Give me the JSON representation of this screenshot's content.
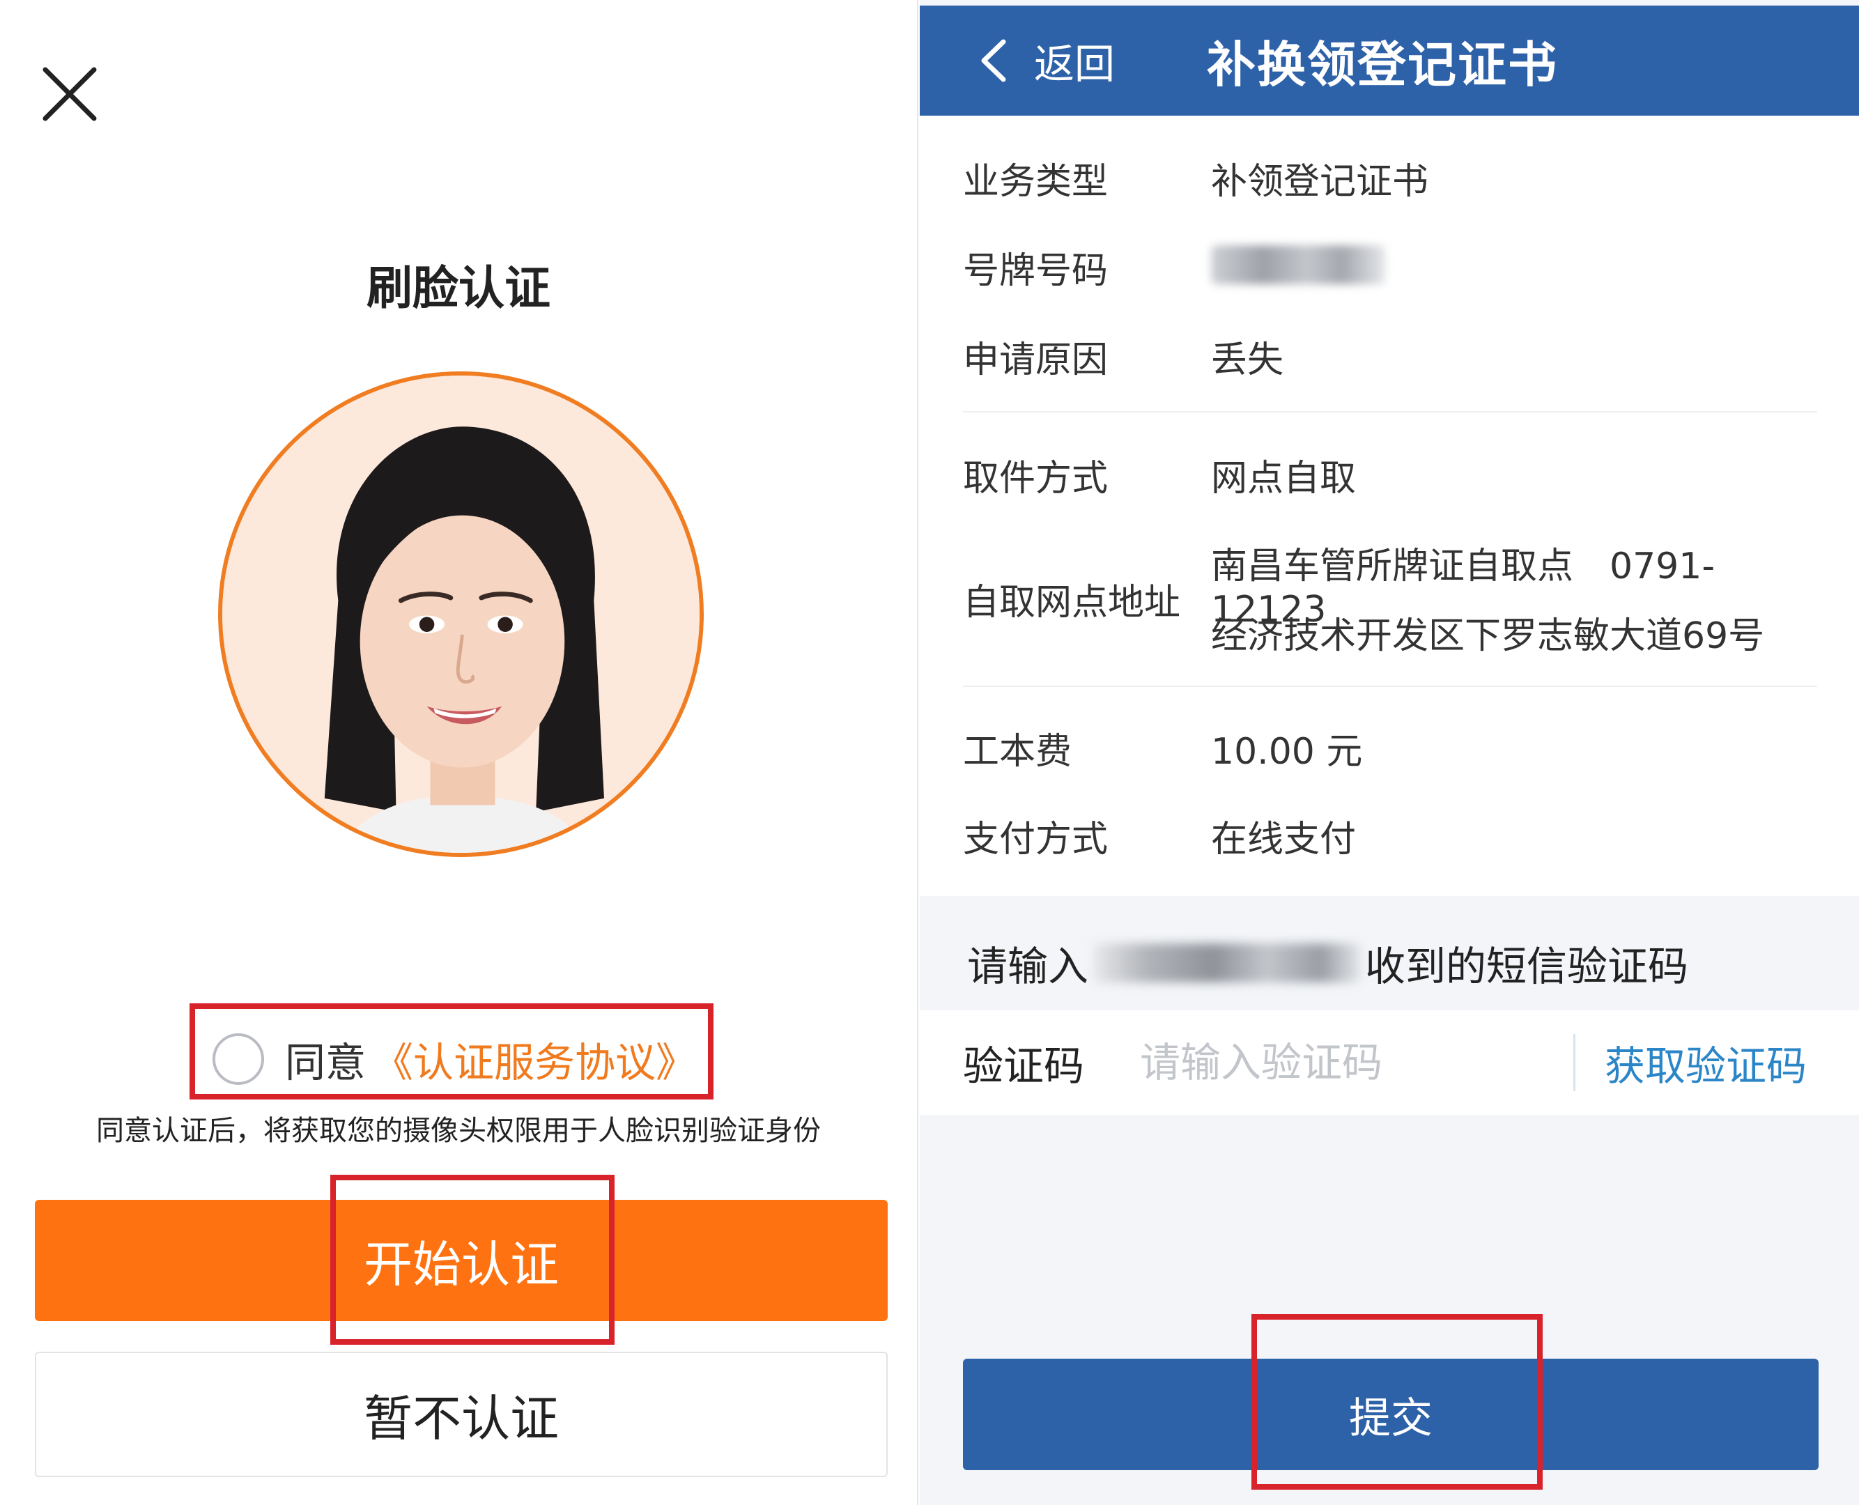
{
  "face_auth": {
    "title": "刷脸认证",
    "agree_label": "同意",
    "agreement_link": "《认证服务协议》",
    "agree_note": "同意认证后，将获取您的摄像头权限用于人脸识别验证身份",
    "start_button": "开始认证",
    "skip_button": "暂不认证",
    "icons": {
      "close": "close-icon",
      "radio": "radio-unchecked"
    },
    "colors": {
      "accent": "#ff7211",
      "ring": "#f07d21",
      "highlight": "#d9232b"
    }
  },
  "reissue_form": {
    "header": {
      "back_label": "返回",
      "title": "补换领登记证书"
    },
    "fields": [
      {
        "label": "业务类型",
        "value": "补领登记证书"
      },
      {
        "label": "号牌号码",
        "value": ""
      },
      {
        "label": "申请原因",
        "value": "丢失"
      },
      {
        "label": "取件方式",
        "value": "网点自取"
      },
      {
        "label": "自取网点地址",
        "value_line1": "南昌车管所牌证自取点　0791-12123",
        "value_line2": "经济技术开发区下罗志敏大道69号"
      },
      {
        "label": "工本费",
        "value": "10.00 元"
      },
      {
        "label": "支付方式",
        "value": "在线支付"
      }
    ],
    "sms": {
      "prompt_prefix": "请输入",
      "prompt_suffix": "收到的短信验证码",
      "code_label": "验证码",
      "code_value": "",
      "code_placeholder": "请输入验证码",
      "get_code_label": "获取验证码"
    },
    "submit_button": "提交",
    "colors": {
      "primary": "#2e62a8",
      "link": "#2b86c8"
    }
  }
}
